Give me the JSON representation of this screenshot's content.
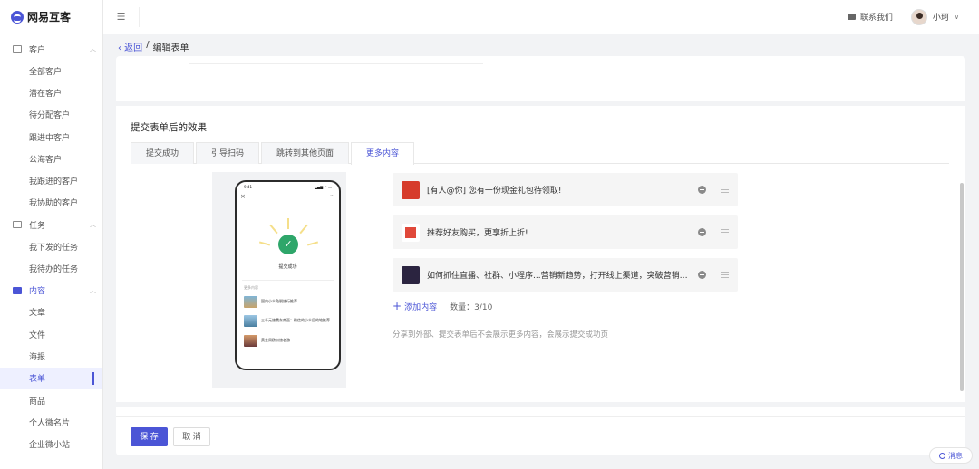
{
  "app": {
    "name": "网易互客"
  },
  "topbar": {
    "menu_toggle_glyph": "☰",
    "contact_label": "联系我们",
    "user_name": "小珂",
    "user_caret": "∨"
  },
  "sidebar": {
    "groups": [
      {
        "label": "客户",
        "icon": "customer-card-icon",
        "items": [
          "全部客户",
          "潜在客户",
          "待分配客户",
          "跟进中客户",
          "公海客户",
          "我跟进的客户",
          "我协助的客户"
        ]
      },
      {
        "label": "任务",
        "icon": "task-icon",
        "items": [
          "我下发的任务",
          "我待办的任务"
        ]
      },
      {
        "label": "内容",
        "icon": "content-icon",
        "items": [
          "文章",
          "文件",
          "海报",
          "表单",
          "商品",
          "个人微名片",
          "企业微小站"
        ]
      }
    ],
    "active_item": "表单"
  },
  "breadcrumb": {
    "back": "‹ 返回",
    "separator": "/",
    "current": "编辑表单"
  },
  "section": {
    "title": "提交表单后的效果"
  },
  "tabs": [
    {
      "label": "提交成功",
      "active": false
    },
    {
      "label": "引导扫码",
      "active": false
    },
    {
      "label": "跳转到其他页面",
      "active": false
    },
    {
      "label": "更多内容",
      "active": true
    }
  ],
  "phone_preview": {
    "time": "9:41",
    "signal": "▂▄▆ ◠ ▭",
    "close": "×",
    "more_icon": "···",
    "check_glyph": "✓",
    "success_text": "提交成功",
    "more_label": "更多内容",
    "items": [
      "国内小众免税旅行推荐",
      "三千元旅费东南亚：微信的小众目的地推荐",
      "黄金周欧洲旅者游"
    ]
  },
  "content_items": [
    {
      "title": "[有人@你] 您有一份现金礼包待领取!",
      "thumb_color": "#d63b2b"
    },
    {
      "title": "推荐好友购买，更享折上折!",
      "thumb_color": "#e0483a"
    },
    {
      "title": "如何抓住直播、社群、小程序...营销新趋势，打开线上渠道，突破营销困...",
      "thumb_color": "#2b2440"
    }
  ],
  "add_content": {
    "label": "添加内容",
    "plus": "+",
    "count_label": "数量：3/10"
  },
  "hint": "分享到外部、提交表单后不会展示更多内容，会展示提交成功页",
  "footer": {
    "save": "保 存",
    "cancel": "取 消"
  },
  "message_fab": {
    "label": "消息"
  },
  "colors": {
    "primary": "#4b55d6",
    "success": "#2ea66a"
  }
}
